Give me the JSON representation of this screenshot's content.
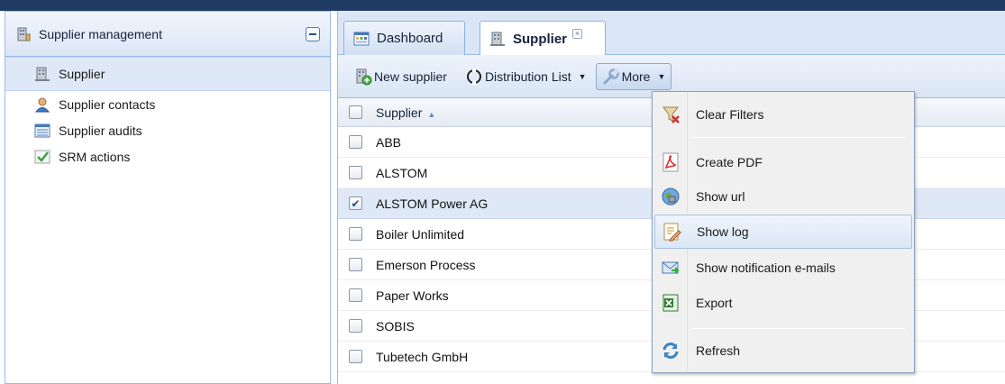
{
  "left_panel": {
    "title": "Supplier management",
    "items": [
      {
        "label": "Supplier",
        "icon": "building-icon",
        "active": true
      },
      {
        "label": "Supplier contacts",
        "icon": "person-icon"
      },
      {
        "label": "Supplier audits",
        "icon": "list-icon"
      },
      {
        "label": "SRM actions",
        "icon": "checkmark-icon"
      }
    ]
  },
  "tabs": [
    {
      "label": "Dashboard",
      "icon": "dashboard-icon",
      "active": false
    },
    {
      "label": "Supplier",
      "icon": "building-icon",
      "active": true,
      "closable": true
    }
  ],
  "toolbar": {
    "new_supplier": "New supplier",
    "distribution_list": "Distribution List",
    "more": "More"
  },
  "grid": {
    "column_header": "Supplier",
    "sort": "ascending",
    "rows": [
      {
        "name": "ABB",
        "checked": false
      },
      {
        "name": "ALSTOM",
        "checked": false
      },
      {
        "name": "ALSTOM Power AG",
        "checked": true
      },
      {
        "name": "Boiler Unlimited",
        "checked": false
      },
      {
        "name": "Emerson Process",
        "checked": false
      },
      {
        "name": "Paper Works",
        "checked": false
      },
      {
        "name": "SOBIS",
        "checked": false
      },
      {
        "name": "Tubetech GmbH",
        "checked": false
      }
    ]
  },
  "more_menu": {
    "items": [
      {
        "label": "Clear Filters",
        "icon": "clear-filter-icon"
      },
      {
        "label": "Create PDF",
        "icon": "pdf-icon"
      },
      {
        "label": "Show url",
        "icon": "globe-icon"
      },
      {
        "label": "Show log",
        "icon": "log-icon",
        "hovered": true
      },
      {
        "label": "Show notification e-mails",
        "icon": "email-icon"
      },
      {
        "label": "Export",
        "icon": "excel-icon"
      },
      {
        "label": "Refresh",
        "icon": "refresh-icon"
      }
    ]
  },
  "colors": {
    "header_bar": "#1f3a63",
    "panel_border": "#99bbe8",
    "selected_row": "#dfe8f6",
    "menu_background": "#f0f0f0"
  }
}
